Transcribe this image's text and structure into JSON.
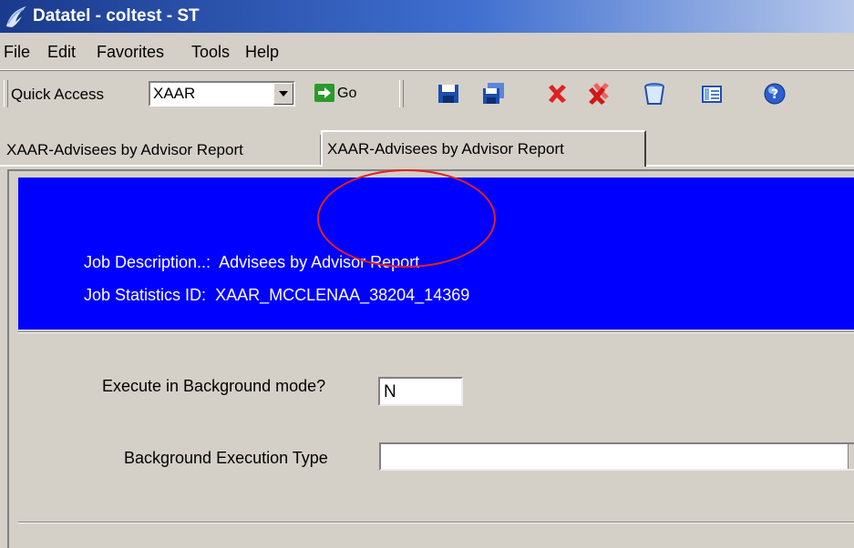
{
  "window": {
    "title": "Datatel - coltest - ST"
  },
  "menu": {
    "items": [
      "File",
      "Edit",
      "Favorites",
      "Tools",
      "Help"
    ]
  },
  "toolbar": {
    "quick_access_label": "Quick Access",
    "quick_access_value": "XAAR",
    "go_label": "Go",
    "icons": [
      "save-icon",
      "save-all-icon",
      "cancel-icon",
      "cancel-all-icon",
      "trash-icon",
      "details-icon",
      "help-icon"
    ]
  },
  "tabs": [
    "XAAR-Advisees by Advisor Report",
    "XAAR-Advisees by Advisor Report"
  ],
  "banner": {
    "job_description_label": "Job Description..:",
    "job_description_value": "Advisees by Advisor Report",
    "job_stats_label": "Job Statistics ID:",
    "job_stats_value": "XAAR_MCCLENAA_38204_14369"
  },
  "form": {
    "execute_background_label": "Execute in Background mode?",
    "execute_background_value": "N",
    "background_type_label": "Background Execution Type",
    "background_type_value": ""
  },
  "colors": {
    "banner": "#0000ff",
    "annotation": "#e0231e",
    "chrome": "#d4d0c8"
  }
}
